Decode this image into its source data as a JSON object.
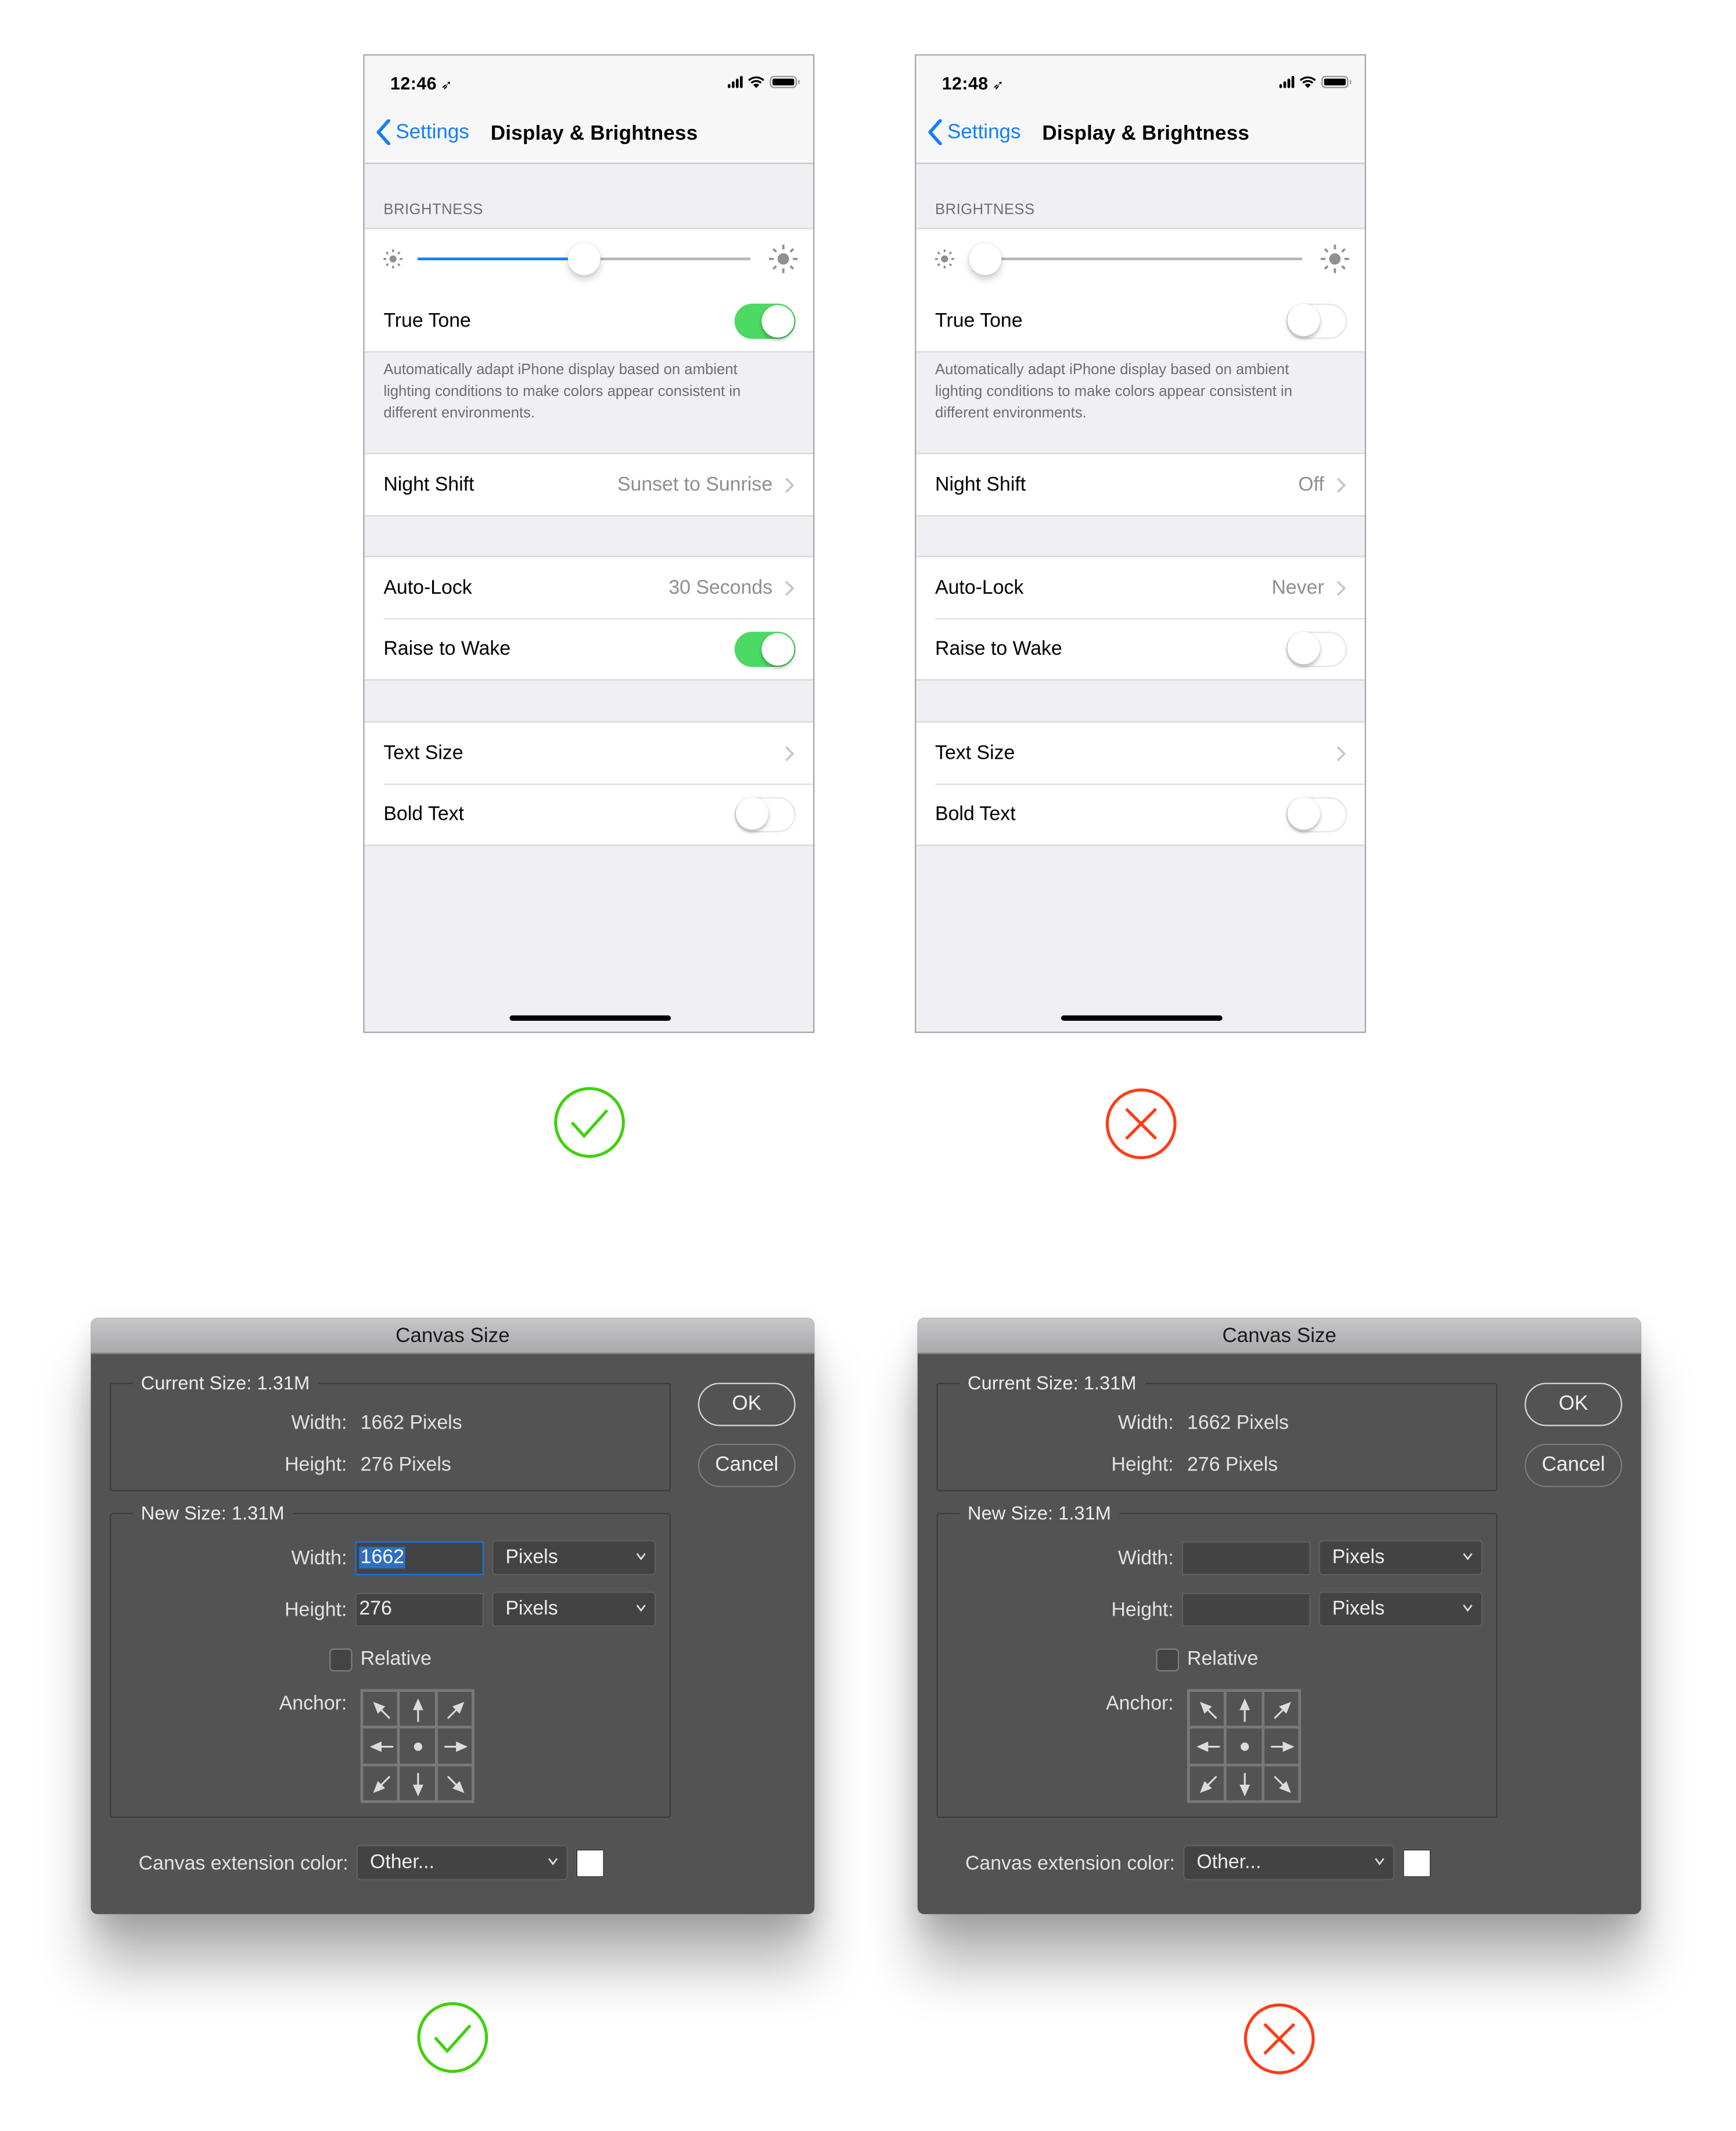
{
  "comparisons": [
    {
      "kind": "iphone-settings",
      "good": {
        "verdict": "correct",
        "status_time": "12:46",
        "nav_back_label": "Settings",
        "nav_title": "Display & Brightness",
        "brightness_header": "BRIGHTNESS",
        "brightness_level": 0.5,
        "true_tone_label": "True Tone",
        "true_tone_on": true,
        "true_tone_description": "Automatically adapt iPhone display based on ambient lighting conditions to make colors appear consistent in different environments.",
        "night_shift_label": "Night Shift",
        "night_shift_value": "Sunset to Sunrise",
        "auto_lock_label": "Auto-Lock",
        "auto_lock_value": "30 Seconds",
        "raise_to_wake_label": "Raise to Wake",
        "raise_to_wake_on": true,
        "text_size_label": "Text Size",
        "bold_text_label": "Bold Text",
        "bold_text_on": false
      },
      "bad": {
        "verdict": "incorrect",
        "status_time": "12:48",
        "nav_back_label": "Settings",
        "nav_title": "Display & Brightness",
        "brightness_header": "BRIGHTNESS",
        "brightness_level": 0.0,
        "true_tone_label": "True Tone",
        "true_tone_on": false,
        "true_tone_description": "Automatically adapt iPhone display based on ambient lighting conditions to make colors appear consistent in different environments.",
        "night_shift_label": "Night Shift",
        "night_shift_value": "Off",
        "auto_lock_label": "Auto-Lock",
        "auto_lock_value": "Never",
        "raise_to_wake_label": "Raise to Wake",
        "raise_to_wake_on": false,
        "text_size_label": "Text Size",
        "bold_text_label": "Bold Text",
        "bold_text_on": false
      }
    },
    {
      "kind": "photoshop-canvas-size",
      "good": {
        "verdict": "correct",
        "title": "Canvas Size",
        "current_size_legend": "Current Size: 1.31M",
        "current_width_label": "Width:",
        "current_width_value": "1662 Pixels",
        "current_height_label": "Height:",
        "current_height_value": "276 Pixels",
        "ok_label": "OK",
        "cancel_label": "Cancel",
        "new_size_legend": "New Size: 1.31M",
        "new_width_label": "Width:",
        "new_width_value": "1662",
        "new_width_selected": true,
        "new_width_unit": "Pixels",
        "new_height_label": "Height:",
        "new_height_value": "276",
        "new_height_unit": "Pixels",
        "relative_label": "Relative",
        "relative_checked": false,
        "anchor_label": "Anchor:",
        "anchor_position": "center",
        "extension_color_label": "Canvas extension color:",
        "extension_color_value": "Other...",
        "extension_swatch_color": "#ffffff"
      },
      "bad": {
        "verdict": "incorrect",
        "title": "Canvas Size",
        "current_size_legend": "Current Size: 1.31M",
        "current_width_label": "Width:",
        "current_width_value": "1662 Pixels",
        "current_height_label": "Height:",
        "current_height_value": "276 Pixels",
        "ok_label": "OK",
        "cancel_label": "Cancel",
        "new_size_legend": "New Size: 1.31M",
        "new_width_label": "Width:",
        "new_width_value": "",
        "new_width_selected": false,
        "new_width_unit": "Pixels",
        "new_height_label": "Height:",
        "new_height_value": "",
        "new_height_unit": "Pixels",
        "relative_label": "Relative",
        "relative_checked": false,
        "anchor_label": "Anchor:",
        "anchor_position": "center",
        "extension_color_label": "Canvas extension color:",
        "extension_color_value": "Other...",
        "extension_swatch_color": "#ffffff"
      }
    }
  ],
  "colors": {
    "ios_blue": "#157efb",
    "ios_switch_green": "#4cd964",
    "verdict_correct": "#3fd10a",
    "verdict_incorrect": "#ff3b14",
    "ps_panel": "#535353",
    "ps_focus": "#1b72de"
  }
}
